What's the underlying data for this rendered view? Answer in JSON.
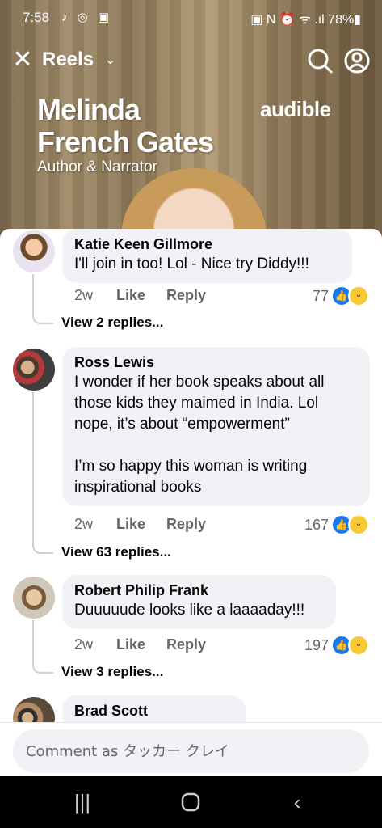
{
  "status_bar": {
    "time": "7:58",
    "app_icons": "♪ ◎ ▣",
    "right": "▣ N ⏰ ᯤ .ıl 78%▮"
  },
  "header": {
    "title": "Reels"
  },
  "video_overlay": {
    "name_line1": "Melinda",
    "name_line2": "French Gates",
    "role": "Author & Narrator",
    "brand": "audible"
  },
  "comments": [
    {
      "author": "Katie Keen Gillmore",
      "text": "I'll join in too! Lol -   Nice try Diddy!!!",
      "time": "2w",
      "like_label": "Like",
      "reply_label": "Reply",
      "reaction_count": "77",
      "view_replies": "View 2 replies..."
    },
    {
      "author": "Ross Lewis",
      "text_lines": [
        "I wonder if her book speaks about all",
        "those kids they maimed in India. Lol",
        "nope, it’s about “empowerment”",
        "",
        "I’m so happy this woman is writing",
        "inspirational books"
      ],
      "time": "2w",
      "like_label": "Like",
      "reply_label": "Reply",
      "reaction_count": "167",
      "view_replies": "View 63 replies..."
    },
    {
      "author": "Robert Philip Frank",
      "text": "Duuuuude looks like a laaaaday!!!",
      "time": "2w",
      "like_label": "Like",
      "reply_label": "Reply",
      "reaction_count": "197",
      "view_replies": "View 3 replies..."
    },
    {
      "author": "Brad Scott"
    }
  ],
  "composer": {
    "placeholder": "Comment as タッカー クレイ"
  },
  "colors": {
    "like_blue": "#1877f2",
    "bubble": "#f0f2f5",
    "meta_gray": "#65676b"
  }
}
